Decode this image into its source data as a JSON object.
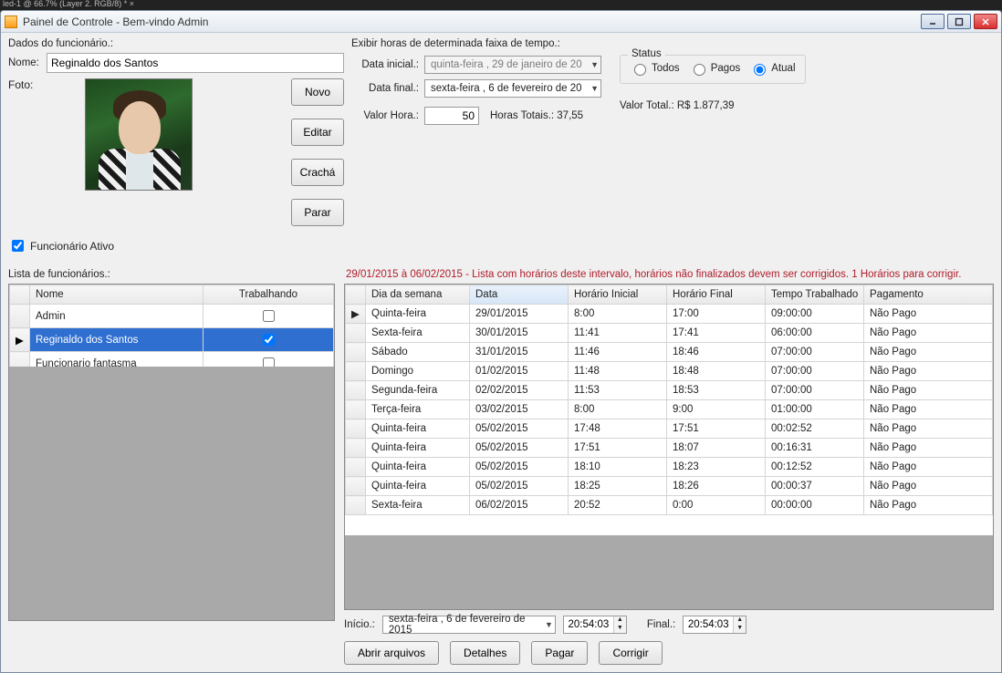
{
  "external_tab": "led-1 @ 66.7% (Layer 2. RGB/8) * ×",
  "window_title": "Painel de Controle - Bem-vindo Admin",
  "emp_panel_title": "Dados do funcionário.:",
  "labels": {
    "nome": "Nome:",
    "foto": "Foto:",
    "ativo": "Funcionário Ativo",
    "lista": "Lista de funcionários.:"
  },
  "emp_name": "Reginaldo dos Santos",
  "emp_ativo": true,
  "buttons": {
    "novo": "Novo",
    "editar": "Editar",
    "cracha": "Crachá",
    "parar": "Parar"
  },
  "time_panel_title": "Exibir horas de determinada faixa de tempo.:",
  "time": {
    "data_inicial_lbl": "Data inicial.:",
    "data_inicial_val": "quinta-feira , 29 de  janeiro   de 20",
    "data_final_lbl": "Data final.:",
    "data_final_val": "sexta-feira  ,  6 de  fevereiro  de 20",
    "valor_hora_lbl": "Valor Hora.:",
    "valor_hora_val": "50",
    "horas_totais_lbl": "Horas Totais.: 37,55",
    "status_legend": "Status",
    "status_todos": "Todos",
    "status_pagos": "Pagos",
    "status_atual": "Atual",
    "valor_total_lbl": "Valor Total.:  R$ 1.877,39"
  },
  "range_msg": "29/01/2015 à 06/02/2015 - Lista com horários deste intervalo, horários não finalizados devem ser corrigidos. 1 Horários para corrigir.",
  "emp_table": {
    "col_nome": "Nome",
    "col_trab": "Trabalhando",
    "rows": [
      {
        "nome": "Admin",
        "working": false,
        "selected": false
      },
      {
        "nome": "Reginaldo dos Santos",
        "working": true,
        "selected": true
      },
      {
        "nome": "Funcionario fantasma",
        "working": false,
        "selected": false
      }
    ]
  },
  "hrs_table": {
    "cols": {
      "dia": "Dia da semana",
      "data": "Data",
      "hi": "Horário Inicial",
      "hf": "Horário Final",
      "tt": "Tempo Trabalhado",
      "pg": "Pagamento"
    },
    "rows": [
      {
        "dia": "Quinta-feira",
        "data": "29/01/2015",
        "hi": "8:00",
        "hf": "17:00",
        "tt": "09:00:00",
        "pg": "Não Pago"
      },
      {
        "dia": "Sexta-feira",
        "data": "30/01/2015",
        "hi": "11:41",
        "hf": "17:41",
        "tt": "06:00:00",
        "pg": "Não Pago"
      },
      {
        "dia": "Sábado",
        "data": "31/01/2015",
        "hi": "11:46",
        "hf": "18:46",
        "tt": "07:00:00",
        "pg": "Não Pago"
      },
      {
        "dia": "Domingo",
        "data": "01/02/2015",
        "hi": "11:48",
        "hf": "18:48",
        "tt": "07:00:00",
        "pg": "Não Pago"
      },
      {
        "dia": "Segunda-feira",
        "data": "02/02/2015",
        "hi": "11:53",
        "hf": "18:53",
        "tt": "07:00:00",
        "pg": "Não Pago"
      },
      {
        "dia": "Terça-feira",
        "data": "03/02/2015",
        "hi": "8:00",
        "hf": "9:00",
        "tt": "01:00:00",
        "pg": "Não Pago"
      },
      {
        "dia": "Quinta-feira",
        "data": "05/02/2015",
        "hi": "17:48",
        "hf": "17:51",
        "tt": "00:02:52",
        "pg": "Não Pago"
      },
      {
        "dia": "Quinta-feira",
        "data": "05/02/2015",
        "hi": "17:51",
        "hf": "18:07",
        "tt": "00:16:31",
        "pg": "Não Pago"
      },
      {
        "dia": "Quinta-feira",
        "data": "05/02/2015",
        "hi": "18:10",
        "hf": "18:23",
        "tt": "00:12:52",
        "pg": "Não Pago"
      },
      {
        "dia": "Quinta-feira",
        "data": "05/02/2015",
        "hi": "18:25",
        "hf": "18:26",
        "tt": "00:00:37",
        "pg": "Não Pago"
      },
      {
        "dia": "Sexta-feira",
        "data": "06/02/2015",
        "hi": "20:52",
        "hf": "0:00",
        "tt": "00:00:00",
        "pg": "Não Pago"
      }
    ]
  },
  "bottom": {
    "inicio_lbl": "Início.:",
    "inicio_date": "sexta-feira ,  6 de  fevereiro  de 2015",
    "inicio_time": "20:54:03",
    "final_lbl": "Final.:",
    "final_time": "20:54:03",
    "abrir": "Abrir arquivos",
    "detalhes": "Detalhes",
    "pagar": "Pagar",
    "corrigir": "Corrigir"
  }
}
